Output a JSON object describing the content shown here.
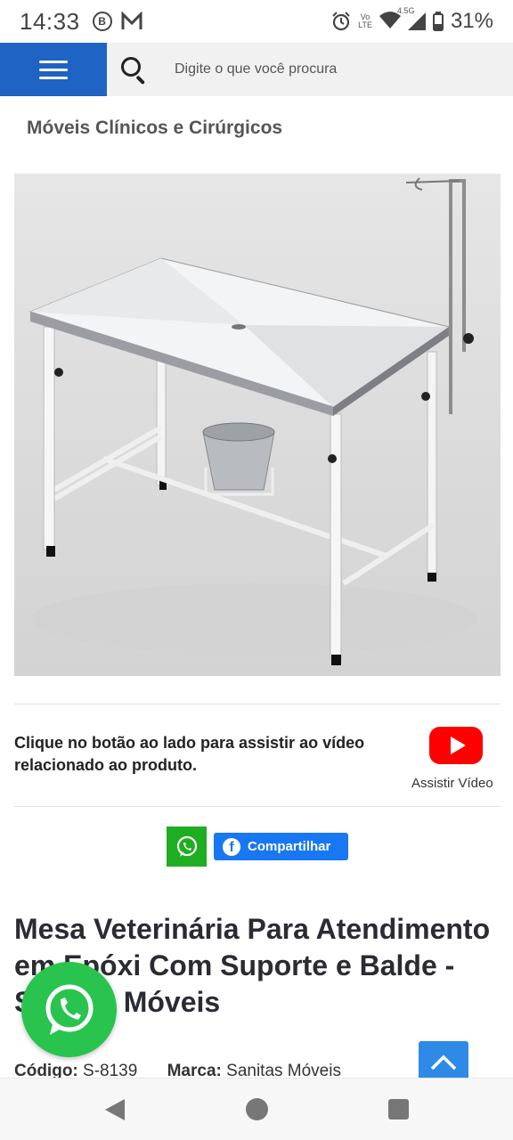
{
  "status_bar": {
    "time": "14:33",
    "left_icons": [
      "b-circle-icon",
      "m-app-icon"
    ],
    "right_icons": [
      "alarm-icon",
      "volte-icon",
      "wifi-icon",
      "signal-icon",
      "battery-icon"
    ],
    "network": "4.5G",
    "volte_top": "Vo",
    "volte_bottom": "LTE",
    "battery": "31%"
  },
  "header": {
    "menu_icon": "hamburger-icon",
    "search_icon": "search-icon",
    "search_placeholder": "Digite o que você procura"
  },
  "breadcrumb": {
    "category": "Móveis Clínicos e Cirúrgicos"
  },
  "video_section": {
    "text": "Clique no botão ao lado para assistir ao vídeo relacionado ao produto.",
    "button_icon": "youtube-icon",
    "button_label": "Assistir Vídeo"
  },
  "share": {
    "whatsapp_icon": "whatsapp-icon",
    "facebook_label": "Compartilhar"
  },
  "product": {
    "title": "Mesa Veterinária Para Atendimento em Epóxi Com Suporte e Balde - Sanitas Móveis",
    "code_label": "Código:",
    "code": "S-8139",
    "brand_label": "Marca:",
    "brand": "Sanitas Móveis"
  },
  "floating": {
    "whatsapp_icon": "whatsapp-icon",
    "back_to_top_icon": "chevron-up-icon"
  },
  "colors": {
    "menu_blue": "#1f63c4",
    "youtube_red": "#ff0000",
    "whatsapp_green": "#1fad21",
    "facebook_blue": "#1877f2",
    "float_green": "#28c44e",
    "back_top_blue": "#2e8ae6"
  }
}
